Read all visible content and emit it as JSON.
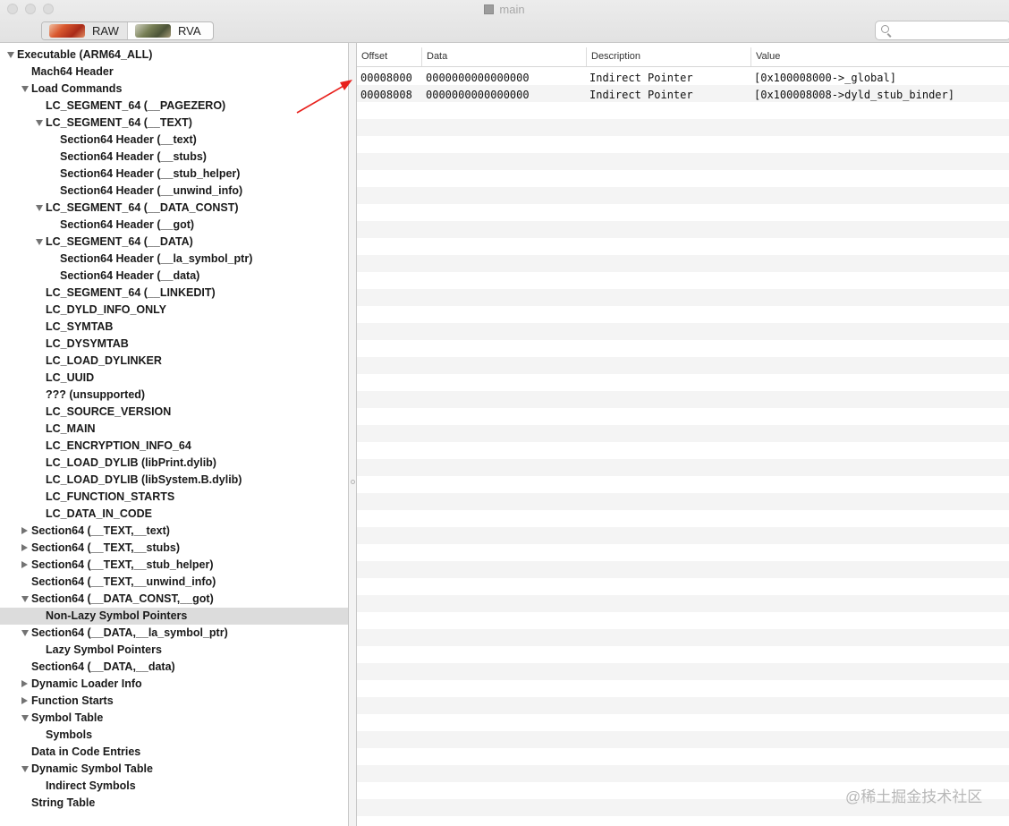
{
  "window": {
    "title": "main"
  },
  "toolbar": {
    "segments": [
      {
        "label": "RAW"
      },
      {
        "label": "RVA"
      }
    ],
    "search_placeholder": ""
  },
  "outline": [
    {
      "label": "Executable  (ARM64_ALL)",
      "level": 0,
      "disclosure": "open"
    },
    {
      "label": "Mach64 Header",
      "level": 1,
      "disclosure": "none"
    },
    {
      "label": "Load Commands",
      "level": 1,
      "disclosure": "open"
    },
    {
      "label": "LC_SEGMENT_64 (__PAGEZERO)",
      "level": 2,
      "disclosure": "none"
    },
    {
      "label": "LC_SEGMENT_64 (__TEXT)",
      "level": 2,
      "disclosure": "open"
    },
    {
      "label": "Section64 Header (__text)",
      "level": 3,
      "disclosure": "none"
    },
    {
      "label": "Section64 Header (__stubs)",
      "level": 3,
      "disclosure": "none"
    },
    {
      "label": "Section64 Header (__stub_helper)",
      "level": 3,
      "disclosure": "none"
    },
    {
      "label": "Section64 Header (__unwind_info)",
      "level": 3,
      "disclosure": "none"
    },
    {
      "label": "LC_SEGMENT_64 (__DATA_CONST)",
      "level": 2,
      "disclosure": "open"
    },
    {
      "label": "Section64 Header (__got)",
      "level": 3,
      "disclosure": "none"
    },
    {
      "label": "LC_SEGMENT_64 (__DATA)",
      "level": 2,
      "disclosure": "open"
    },
    {
      "label": "Section64 Header (__la_symbol_ptr)",
      "level": 3,
      "disclosure": "none"
    },
    {
      "label": "Section64 Header (__data)",
      "level": 3,
      "disclosure": "none"
    },
    {
      "label": "LC_SEGMENT_64 (__LINKEDIT)",
      "level": 2,
      "disclosure": "none"
    },
    {
      "label": "LC_DYLD_INFO_ONLY",
      "level": 2,
      "disclosure": "none"
    },
    {
      "label": "LC_SYMTAB",
      "level": 2,
      "disclosure": "none"
    },
    {
      "label": "LC_DYSYMTAB",
      "level": 2,
      "disclosure": "none"
    },
    {
      "label": "LC_LOAD_DYLINKER",
      "level": 2,
      "disclosure": "none"
    },
    {
      "label": "LC_UUID",
      "level": 2,
      "disclosure": "none"
    },
    {
      "label": "??? (unsupported)",
      "level": 2,
      "disclosure": "none"
    },
    {
      "label": "LC_SOURCE_VERSION",
      "level": 2,
      "disclosure": "none"
    },
    {
      "label": "LC_MAIN",
      "level": 2,
      "disclosure": "none"
    },
    {
      "label": "LC_ENCRYPTION_INFO_64",
      "level": 2,
      "disclosure": "none"
    },
    {
      "label": "LC_LOAD_DYLIB (libPrint.dylib)",
      "level": 2,
      "disclosure": "none"
    },
    {
      "label": "LC_LOAD_DYLIB (libSystem.B.dylib)",
      "level": 2,
      "disclosure": "none"
    },
    {
      "label": "LC_FUNCTION_STARTS",
      "level": 2,
      "disclosure": "none"
    },
    {
      "label": "LC_DATA_IN_CODE",
      "level": 2,
      "disclosure": "none"
    },
    {
      "label": "Section64 (__TEXT,__text)",
      "level": 1,
      "disclosure": "closed"
    },
    {
      "label": "Section64 (__TEXT,__stubs)",
      "level": 1,
      "disclosure": "closed"
    },
    {
      "label": "Section64 (__TEXT,__stub_helper)",
      "level": 1,
      "disclosure": "closed"
    },
    {
      "label": "Section64 (__TEXT,__unwind_info)",
      "level": 1,
      "disclosure": "none"
    },
    {
      "label": "Section64 (__DATA_CONST,__got)",
      "level": 1,
      "disclosure": "open"
    },
    {
      "label": "Non-Lazy Symbol Pointers",
      "level": 2,
      "disclosure": "none",
      "selected": true
    },
    {
      "label": "Section64 (__DATA,__la_symbol_ptr)",
      "level": 1,
      "disclosure": "open"
    },
    {
      "label": "Lazy Symbol Pointers",
      "level": 2,
      "disclosure": "none"
    },
    {
      "label": "Section64 (__DATA,__data)",
      "level": 1,
      "disclosure": "none"
    },
    {
      "label": "Dynamic Loader Info",
      "level": 1,
      "disclosure": "closed"
    },
    {
      "label": "Function Starts",
      "level": 1,
      "disclosure": "closed"
    },
    {
      "label": "Symbol Table",
      "level": 1,
      "disclosure": "open"
    },
    {
      "label": "Symbols",
      "level": 2,
      "disclosure": "none"
    },
    {
      "label": "Data in Code Entries",
      "level": 1,
      "disclosure": "none"
    },
    {
      "label": "Dynamic Symbol Table",
      "level": 1,
      "disclosure": "open"
    },
    {
      "label": "Indirect Symbols",
      "level": 2,
      "disclosure": "none"
    },
    {
      "label": "String Table",
      "level": 1,
      "disclosure": "none"
    }
  ],
  "table": {
    "columns": [
      "Offset",
      "Data",
      "Description",
      "Value"
    ],
    "rows": [
      {
        "offset": "00008000",
        "data": "0000000000000000",
        "description": "Indirect Pointer",
        "value": "[0x100008000->_global]"
      },
      {
        "offset": "00008008",
        "data": "0000000000000000",
        "description": "Indirect Pointer",
        "value": "[0x100008008->dyld_stub_binder]"
      }
    ]
  },
  "annotation": {
    "arrow_color": "#e8201c"
  },
  "watermark": "@稀土掘金技术社区"
}
